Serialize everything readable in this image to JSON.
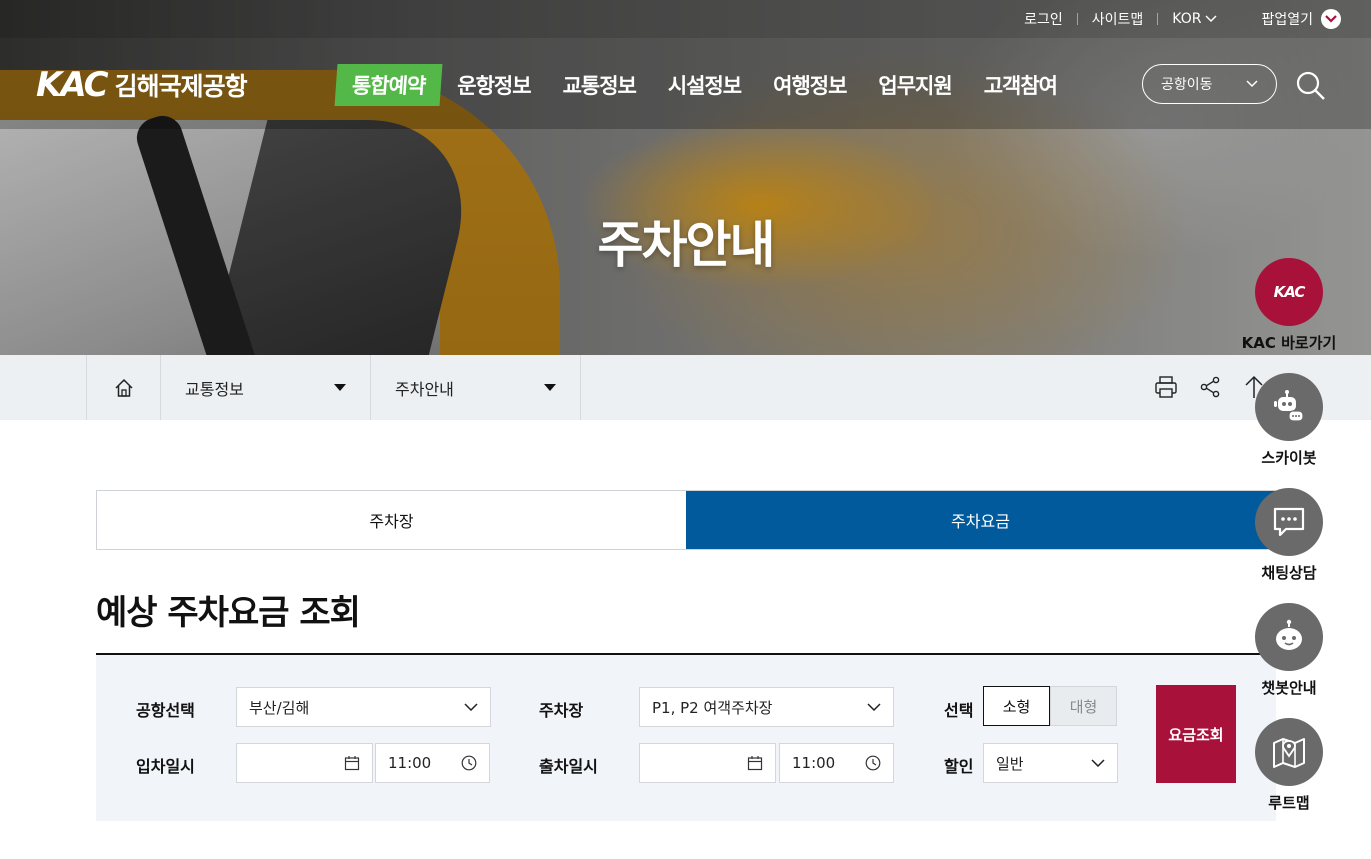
{
  "util": {
    "login": "로그인",
    "sitemap": "사이트맵",
    "language": "KOR",
    "popup": "팝업열기"
  },
  "header": {
    "logo_mark": "KAC",
    "logo_name": "김해국제공항",
    "menu": [
      "통합예약",
      "운항정보",
      "교통정보",
      "시설정보",
      "여행정보",
      "업무지원",
      "고객참여"
    ],
    "airport_move": "공항이동"
  },
  "hero": {
    "title": "주차안내"
  },
  "breadcrumb": {
    "level1": "교통정보",
    "level2": "주차안내"
  },
  "tabs": [
    {
      "label": "주차장"
    },
    {
      "label": "주차요금"
    }
  ],
  "section": {
    "title": "예상 주차요금 조회"
  },
  "form": {
    "airport_label": "공항선택",
    "airport_value": "부산/김해",
    "parking_label": "주차장",
    "parking_value": "P1, P2 여객주차장",
    "select_label": "선택",
    "size_small": "소형",
    "size_large": "대형",
    "entry_label": "입차일시",
    "entry_time": "11:00",
    "exit_label": "출차일시",
    "exit_time": "11:00",
    "discount_label": "할인",
    "discount_value": "일반",
    "submit": "요금조회"
  },
  "quick_menu": [
    {
      "label": "KAC 바로가기",
      "icon": "kac-logo-icon"
    },
    {
      "label": "스카이봇",
      "icon": "skybot-icon"
    },
    {
      "label": "채팅상담",
      "icon": "chat-icon"
    },
    {
      "label": "챗봇안내",
      "icon": "chatbot-icon"
    },
    {
      "label": "루트맵",
      "icon": "route-map-icon"
    }
  ],
  "colors": {
    "brand_red": "#a8113a",
    "tab_active": "#005a9c",
    "menu_highlight": "#54b848"
  }
}
